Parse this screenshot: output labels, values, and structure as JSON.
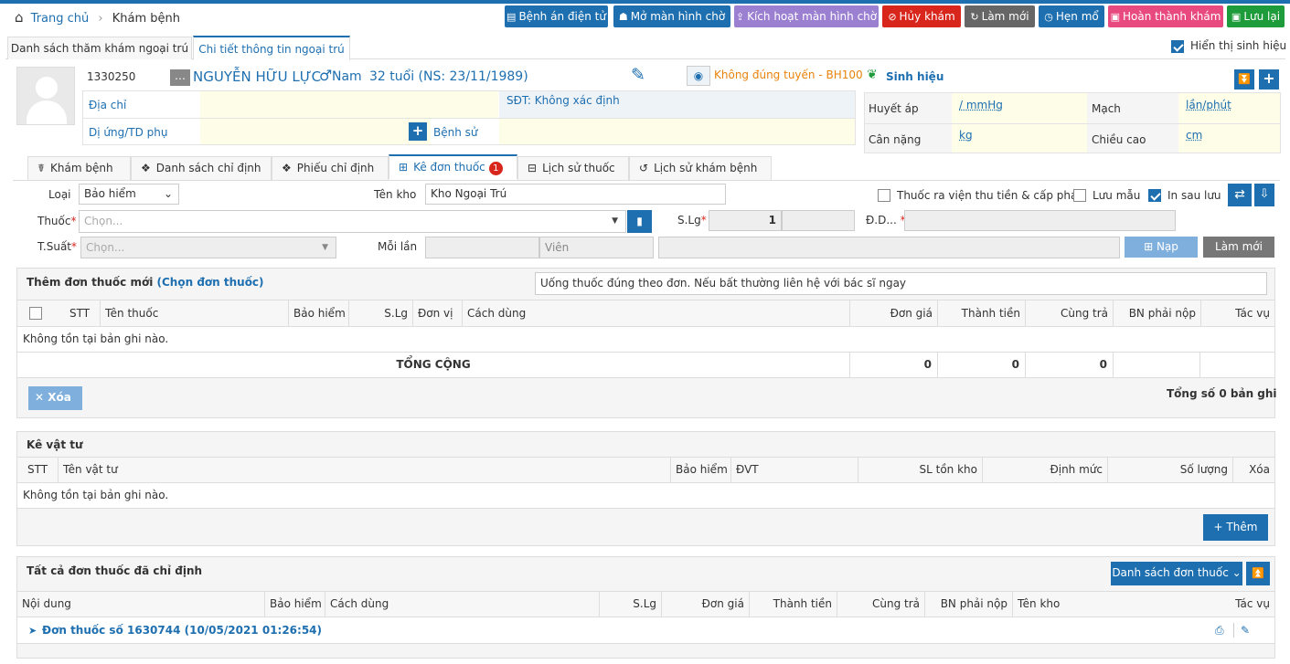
{
  "breadcrumb": {
    "home": "Trang chủ",
    "current": "Khám bệnh"
  },
  "toolbar": {
    "btn1": "Bệnh án điện tử",
    "btn2": "Mở màn hình chờ",
    "btn3": "Kích hoạt màn hình chờ",
    "btn4": "Hủy khám",
    "btn5": "Làm mới",
    "btn6": "Hẹn mổ",
    "btn7": "Hoàn thành khám",
    "btn8": "Lưu lại"
  },
  "main_tabs": {
    "list": "Danh sách thăm khám ngoại trú",
    "detail": "Chi tiết thông tin ngoại trú"
  },
  "show_vitals": "Hiển thị sinh hiệu",
  "patient": {
    "id": "1330250",
    "name": "NGUYỄN HỮU LỰC",
    "gender": "Nam",
    "age": "32 tuổi (NS: 23/11/1989)",
    "insurance": "Không đúng tuyến - BH100",
    "address_label": "Địa chỉ",
    "phone": "SĐT: Không xác định",
    "allergy_label": "Dị ứng/TD phụ",
    "history_label": "Bệnh sử"
  },
  "vitals": {
    "title": "Sinh hiệu",
    "bp_label": "Huyết áp",
    "bp_unit": "/ mmHg",
    "pulse_label": "Mạch",
    "pulse_unit": "lần/phút",
    "weight_label": "Cân nặng",
    "weight_unit": "kg",
    "height_label": "Chiều cao",
    "height_unit": "cm"
  },
  "tabs": {
    "t1": "Khám bệnh",
    "t2": "Danh sách chỉ định",
    "t3": "Phiếu chỉ định",
    "t4": "Kê đơn thuốc",
    "t4_badge": "1",
    "t5": "Lịch sử thuốc",
    "t6": "Lịch sử khám bệnh"
  },
  "form": {
    "type_label": "Loại",
    "type_value": "Bảo hiểm",
    "store_label": "Tên kho",
    "store_value": "Kho Ngoại Trú",
    "opt1": "Thuốc ra viện thu tiền & cấp phát",
    "opt2": "Lưu mẫu",
    "opt3": "In sau lưu",
    "drug_label": "Thuốc",
    "drug_placeholder": "Chọn...",
    "qty_label": "S.Lg",
    "qty_value": "1",
    "dd_label": "Đ.D...",
    "ts_label": "T.Suất",
    "ts_placeholder": "Chọn...",
    "each_label": "Mỗi lần",
    "unit_placeholder": "Viên",
    "load_btn": "Nạp",
    "reset_btn": "Làm mới"
  },
  "new_rx": {
    "title": "Thêm đơn thuốc mới",
    "choose": "(Chọn đơn thuốc)",
    "note": "Uống thuốc đúng theo đơn. Nếu bất thường liên hệ với bác sĩ ngay",
    "cols": [
      "STT",
      "Tên thuốc",
      "Bảo hiểm",
      "S.Lg",
      "Đơn vị",
      "Cách dùng",
      "Đơn giá",
      "Thành tiền",
      "Cùng trả",
      "BN phải nộp",
      "Tác vụ"
    ],
    "empty": "Không tồn tại bản ghi nào.",
    "total_label": "TỔNG CỘNG",
    "total1": "0",
    "total2": "0",
    "total3": "0",
    "delete_btn": "Xóa",
    "count_label": "Tổng số",
    "count": "0",
    "count_unit": "bản ghi"
  },
  "supplies": {
    "title": "Kê vật tư",
    "cols": [
      "STT",
      "Tên vật tư",
      "Bảo hiểm",
      "ĐVT",
      "SL tồn kho",
      "Định mức",
      "Số lượng",
      "Xóa"
    ],
    "empty": "Không tồn tại bản ghi nào.",
    "add_btn": "Thêm"
  },
  "all_rx": {
    "title": "Tất cả đơn thuốc đã chỉ định",
    "list_btn": "Danh sách đơn thuốc",
    "cols": [
      "Nội dung",
      "Bảo hiểm",
      "Cách dùng",
      "S.Lg",
      "Đơn giá",
      "Thành tiền",
      "Cùng trả",
      "BN phải nộp",
      "Tên kho",
      "Tác vụ"
    ],
    "row": "Đơn thuốc số 1630744 (10/05/2021 01:26:54)"
  },
  "colors": {
    "primary": "#1e6fb0",
    "danger": "#d9261c",
    "pink": "#e84a7f",
    "green": "#1e9b3a",
    "purple": "#9b7fd1",
    "grey": "#666666"
  }
}
